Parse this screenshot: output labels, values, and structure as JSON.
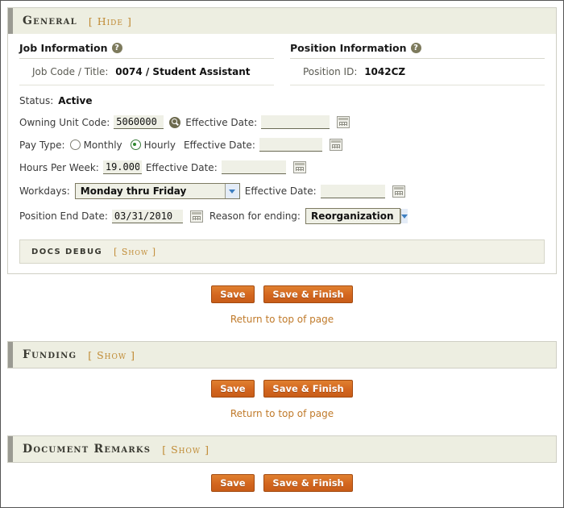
{
  "sections": {
    "general": {
      "title": "General",
      "toggle": "Hide",
      "job_information": {
        "heading": "Job Information",
        "help_icon": "help-question-icon",
        "row_label": "Job Code / Title:",
        "row_value": "0074 / Student Assistant"
      },
      "position_information": {
        "heading": "Position Information",
        "help_icon": "help-question-icon",
        "row_label": "Position ID:",
        "row_value": "1042CZ"
      },
      "form": {
        "status_label": "Status:",
        "status_value": "Active",
        "owning_unit_label": "Owning Unit Code:",
        "owning_unit_value": "5060000",
        "owning_unit_lookup_icon": "magnifier-icon",
        "owning_unit_effective_label": "Effective Date:",
        "owning_unit_effective_value": "",
        "owning_unit_effective_placeholder": "",
        "pay_type_label": "Pay Type:",
        "pay_type_monthly": "Monthly",
        "pay_type_hourly": "Hourly",
        "pay_type_selected": "Hourly",
        "pay_type_effective_label": "Effective Date:",
        "pay_type_effective_value": "",
        "hours_label": "Hours Per Week:",
        "hours_value": "19.000",
        "hours_effective_label": "Effective Date:",
        "hours_effective_value": "",
        "workdays_label": "Workdays:",
        "workdays_value": "Monday thru Friday",
        "workdays_options": [
          "Monday thru Friday"
        ],
        "workdays_effective_label": "Effective Date:",
        "workdays_effective_value": "",
        "end_date_label": "Position End Date:",
        "end_date_value": "03/31/2010",
        "reason_label": "Reason for ending:",
        "reason_value": "Reorganization",
        "reason_options": [
          "Reorganization"
        ],
        "calendar_icon": "calendar-icon"
      },
      "docs_debug": {
        "title": "DOCS DEBUG",
        "toggle": "Show"
      },
      "actions": {
        "save": "Save",
        "save_finish": "Save & Finish",
        "return_link": "Return to top of page"
      }
    },
    "funding": {
      "title": "Funding",
      "toggle": "Show",
      "actions": {
        "save": "Save",
        "save_finish": "Save & Finish",
        "return_link": "Return to top of page"
      }
    },
    "document_remarks": {
      "title": "Document Remarks",
      "toggle": "Show",
      "actions": {
        "save": "Save",
        "save_finish": "Save & Finish"
      }
    }
  },
  "colors": {
    "accent_orange": "#c07a2a",
    "button_orange": "#d3661f",
    "header_band": "#edeee1",
    "accent_bar": "#9a9a92",
    "selected_radio": "#2f8a2f"
  },
  "brackets": {
    "open": "[",
    "close": "]"
  }
}
